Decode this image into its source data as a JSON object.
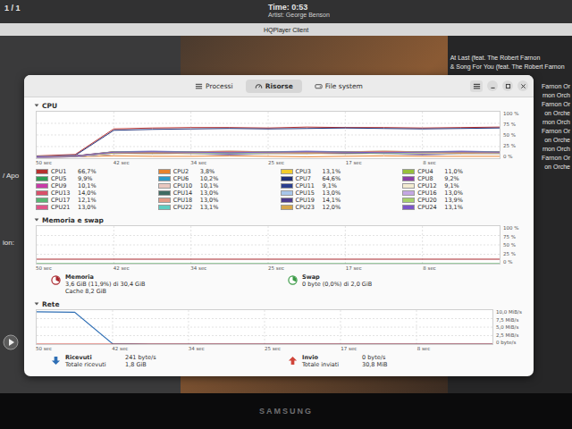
{
  "background_app": {
    "top_bar": {
      "page": "1 / 1",
      "time": "Time: 0:53",
      "artist": "Artist: George Benson"
    },
    "title": "HQPlayer Client",
    "left_fragments": [
      "/ Apo",
      "ion:"
    ],
    "playlist_visible": [
      "At Last (feat. The Robert Farnon",
      "& Song For You (feat. The Robert Farnon"
    ],
    "playlist_fragments": [
      "Farnon Or",
      "rnon Orch",
      "Farnon Or",
      "on Orche",
      "rnon Orch",
      "Farnon Or",
      "on Orche",
      "rnon Orch",
      "Farnon Or",
      "on Orche"
    ]
  },
  "window": {
    "tabs": [
      {
        "label": "Processi",
        "selected": false
      },
      {
        "label": "Risorse",
        "selected": true
      },
      {
        "label": "File system",
        "selected": false
      }
    ]
  },
  "cpu": {
    "title": "CPU",
    "x_ticks": [
      "50 sec",
      "42 sec",
      "34 sec",
      "25 sec",
      "17 sec",
      "8 sec"
    ],
    "y_ticks": [
      "100 %",
      "75 %",
      "50 %",
      "25 %",
      "0 %"
    ],
    "cores": [
      {
        "name": "CPU1",
        "reading": "66,7%",
        "color": "#b8312f",
        "values": [
          5,
          8,
          63,
          65,
          66,
          66,
          65,
          67,
          66,
          66,
          65,
          66,
          67
        ]
      },
      {
        "name": "CPU2",
        "reading": "3,8%",
        "color": "#e8822c",
        "values": [
          2,
          3,
          5,
          4,
          4,
          5,
          4,
          3,
          4,
          5,
          4,
          4,
          4
        ]
      },
      {
        "name": "CPU3",
        "reading": "13,1%",
        "color": "#f2cc2c",
        "values": [
          3,
          5,
          12,
          13,
          12,
          14,
          13,
          12,
          13,
          14,
          13,
          12,
          13
        ]
      },
      {
        "name": "CPU4",
        "reading": "11,0%",
        "color": "#96c03a",
        "values": [
          3,
          4,
          11,
          10,
          12,
          11,
          10,
          11,
          12,
          11,
          10,
          11,
          11
        ]
      },
      {
        "name": "CPU5",
        "reading": "9,9%",
        "color": "#2f9e55",
        "values": [
          2,
          4,
          10,
          9,
          10,
          11,
          9,
          10,
          9,
          10,
          11,
          9,
          10
        ]
      },
      {
        "name": "CPU6",
        "reading": "10,2%",
        "color": "#2e9bc9",
        "values": [
          3,
          4,
          10,
          11,
          10,
          9,
          10,
          11,
          10,
          9,
          10,
          11,
          10
        ]
      },
      {
        "name": "CPU7",
        "reading": "64,6%",
        "color": "#1f2f78",
        "values": [
          4,
          6,
          60,
          62,
          63,
          64,
          63,
          64,
          65,
          64,
          63,
          64,
          65
        ]
      },
      {
        "name": "CPU8",
        "reading": "9,2%",
        "color": "#8a3fa8",
        "values": [
          2,
          3,
          9,
          10,
          9,
          8,
          9,
          10,
          9,
          9,
          8,
          9,
          9
        ]
      },
      {
        "name": "CPU9",
        "reading": "10,1%",
        "color": "#c93aa8",
        "values": [
          2,
          4,
          10,
          11,
          10,
          9,
          10,
          10,
          11,
          10,
          9,
          10,
          10
        ]
      },
      {
        "name": "CPU10",
        "reading": "10,1%",
        "color": "#e9c8c0",
        "values": [
          3,
          4,
          10,
          9,
          10,
          11,
          10,
          10,
          9,
          10,
          11,
          10,
          10
        ]
      },
      {
        "name": "CPU11",
        "reading": "9,1%",
        "color": "#2b3f8f",
        "values": [
          2,
          3,
          9,
          10,
          9,
          8,
          9,
          9,
          10,
          9,
          8,
          9,
          9
        ]
      },
      {
        "name": "CPU12",
        "reading": "9,1%",
        "color": "#f3ecd2",
        "values": [
          2,
          3,
          9,
          8,
          9,
          10,
          9,
          9,
          8,
          9,
          10,
          9,
          9
        ]
      },
      {
        "name": "CPU13",
        "reading": "14,0%",
        "color": "#d9506a",
        "values": [
          3,
          5,
          14,
          13,
          14,
          15,
          14,
          13,
          14,
          15,
          14,
          13,
          14
        ]
      },
      {
        "name": "CPU14",
        "reading": "13,0%",
        "color": "#3f6b63",
        "values": [
          3,
          4,
          13,
          12,
          13,
          14,
          13,
          12,
          13,
          14,
          13,
          12,
          13
        ]
      },
      {
        "name": "CPU15",
        "reading": "13,0%",
        "color": "#a8c6ea",
        "values": [
          3,
          4,
          13,
          14,
          13,
          12,
          13,
          14,
          13,
          12,
          13,
          14,
          13
        ]
      },
      {
        "name": "CPU16",
        "reading": "13,0%",
        "color": "#c4a7e3",
        "values": [
          3,
          4,
          13,
          12,
          13,
          14,
          13,
          12,
          13,
          14,
          13,
          12,
          13
        ]
      },
      {
        "name": "CPU17",
        "reading": "12,1%",
        "color": "#57b874",
        "values": [
          3,
          4,
          12,
          13,
          12,
          11,
          12,
          13,
          12,
          11,
          12,
          13,
          12
        ]
      },
      {
        "name": "CPU18",
        "reading": "13,0%",
        "color": "#e29a86",
        "values": [
          3,
          5,
          13,
          14,
          13,
          12,
          13,
          14,
          13,
          12,
          13,
          14,
          13
        ]
      },
      {
        "name": "CPU19",
        "reading": "14,1%",
        "color": "#4c3b8c",
        "values": [
          3,
          5,
          14,
          15,
          14,
          13,
          14,
          15,
          14,
          13,
          14,
          15,
          14
        ]
      },
      {
        "name": "CPU20",
        "reading": "13,9%",
        "color": "#a6d16a",
        "values": [
          3,
          4,
          14,
          13,
          14,
          15,
          14,
          13,
          14,
          15,
          14,
          13,
          14
        ]
      },
      {
        "name": "CPU21",
        "reading": "13,0%",
        "color": "#e0558a",
        "values": [
          3,
          4,
          13,
          12,
          13,
          14,
          13,
          12,
          13,
          14,
          13,
          12,
          13
        ]
      },
      {
        "name": "CPU22",
        "reading": "13,1%",
        "color": "#5ccdc2",
        "values": [
          3,
          4,
          13,
          14,
          13,
          12,
          13,
          14,
          13,
          12,
          13,
          14,
          13
        ]
      },
      {
        "name": "CPU23",
        "reading": "12,0%",
        "color": "#d6a64a",
        "values": [
          3,
          4,
          12,
          11,
          12,
          13,
          12,
          11,
          12,
          13,
          12,
          11,
          12
        ]
      },
      {
        "name": "CPU24",
        "reading": "13,1%",
        "color": "#7c55c8",
        "values": [
          3,
          4,
          13,
          14,
          13,
          12,
          13,
          14,
          13,
          12,
          13,
          14,
          13
        ]
      }
    ]
  },
  "memory": {
    "title": "Memoria e swap",
    "x_ticks": [
      "50 sec",
      "42 sec",
      "34 sec",
      "25 sec",
      "17 sec",
      "8 sec"
    ],
    "y_ticks": [
      "100 %",
      "75 %",
      "50 %",
      "25 %",
      "0 %"
    ],
    "series": [
      {
        "name": "Memoria",
        "reading": "3,6 GiB (11,9%) di 30,4 GiB",
        "detail": "Cache 8,2 GiB",
        "color": "#a8262c",
        "values": [
          11.9,
          11.9,
          11.9,
          11.9,
          11.9,
          11.9,
          11.9,
          11.9,
          11.9,
          11.9,
          11.9,
          11.9,
          11.9
        ]
      },
      {
        "name": "Swap",
        "reading": "0 byte (0,0%) di 2,0 GiB",
        "detail": "",
        "color": "#3a9a45",
        "values": [
          0,
          0,
          0,
          0,
          0,
          0,
          0,
          0,
          0,
          0,
          0,
          0,
          0
        ]
      }
    ]
  },
  "network": {
    "title": "Rete",
    "x_ticks": [
      "50 sec",
      "42 sec",
      "34 sec",
      "25 sec",
      "17 sec",
      "8 sec"
    ],
    "y_ticks": [
      "10,0 MiB/s",
      "7,5 MiB/s",
      "5,0 MiB/s",
      "2,5 MiB/s",
      "0 byte/s"
    ],
    "series": [
      {
        "name": "Ricevuti",
        "rate": "241 byte/s",
        "total_label": "Totale ricevuti",
        "total": "1,8 GiB",
        "color": "#2f6fb5",
        "values": [
          9.5,
          9.4,
          0.1,
          0,
          0,
          0,
          0,
          0,
          0,
          0,
          0,
          0,
          0
        ]
      },
      {
        "name": "Invio",
        "rate": "0 byte/s",
        "total_label": "Totale inviati",
        "total": "30,8 MiB",
        "color": "#d0453a",
        "values": [
          0,
          0,
          0,
          0,
          0,
          0,
          0,
          0,
          0,
          0,
          0,
          0,
          0
        ]
      }
    ]
  },
  "monitor": {
    "brand": "SAMSUNG"
  }
}
